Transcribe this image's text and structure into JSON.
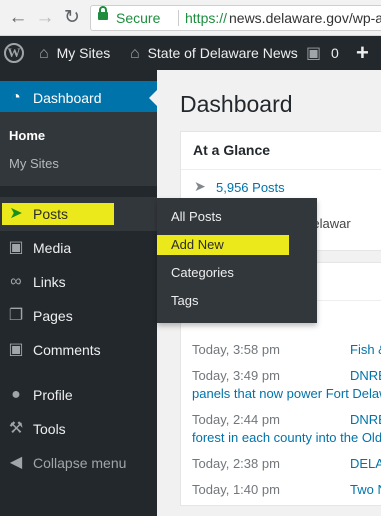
{
  "browser": {
    "secure_label": "Secure",
    "url_scheme": "https://",
    "url_rest": "news.delaware.gov/wp-ad",
    "back_icon": "arrow-left-icon",
    "forward_icon": "arrow-right-icon",
    "reload_icon": "reload-icon"
  },
  "adminbar": {
    "my_sites": "My Sites",
    "site_name": "State of Delaware News",
    "comments_count": "0",
    "new_icon": "+"
  },
  "sidebar": {
    "dashboard": "Dashboard",
    "home": "Home",
    "my_sites": "My Sites",
    "posts": "Posts",
    "media": "Media",
    "links": "Links",
    "pages": "Pages",
    "comments": "Comments",
    "profile": "Profile",
    "tools": "Tools",
    "collapse": "Collapse menu"
  },
  "flyout": {
    "all_posts": "All Posts",
    "add_new": "Add New",
    "categories": "Categories",
    "tags": "Tags"
  },
  "main": {
    "title": "Dashboard",
    "at_a_glance": "At a Glance",
    "posts_count": "5,956 Posts",
    "glance_text": "ing Delawar",
    "activity": [
      {
        "time": "Today, 3:58 pm",
        "title": "Fish &"
      },
      {
        "time": "Today, 3:49 pm",
        "title": "DNRE",
        "continuation": "panels that now power Fort Delaw"
      },
      {
        "time": "Today, 2:44 pm",
        "title": "DNRE",
        "continuation": "forest in each county into the Old"
      },
      {
        "time": "Today, 2:38 pm",
        "title": "DELA"
      },
      {
        "time": "Today, 1:40 pm",
        "title": "Two N"
      }
    ]
  },
  "colors": {
    "sidebar_bg": "#23282d",
    "current_blue": "#0073aa",
    "highlight_yellow": "#f6f21a",
    "secure_green": "#1e8e3e"
  }
}
